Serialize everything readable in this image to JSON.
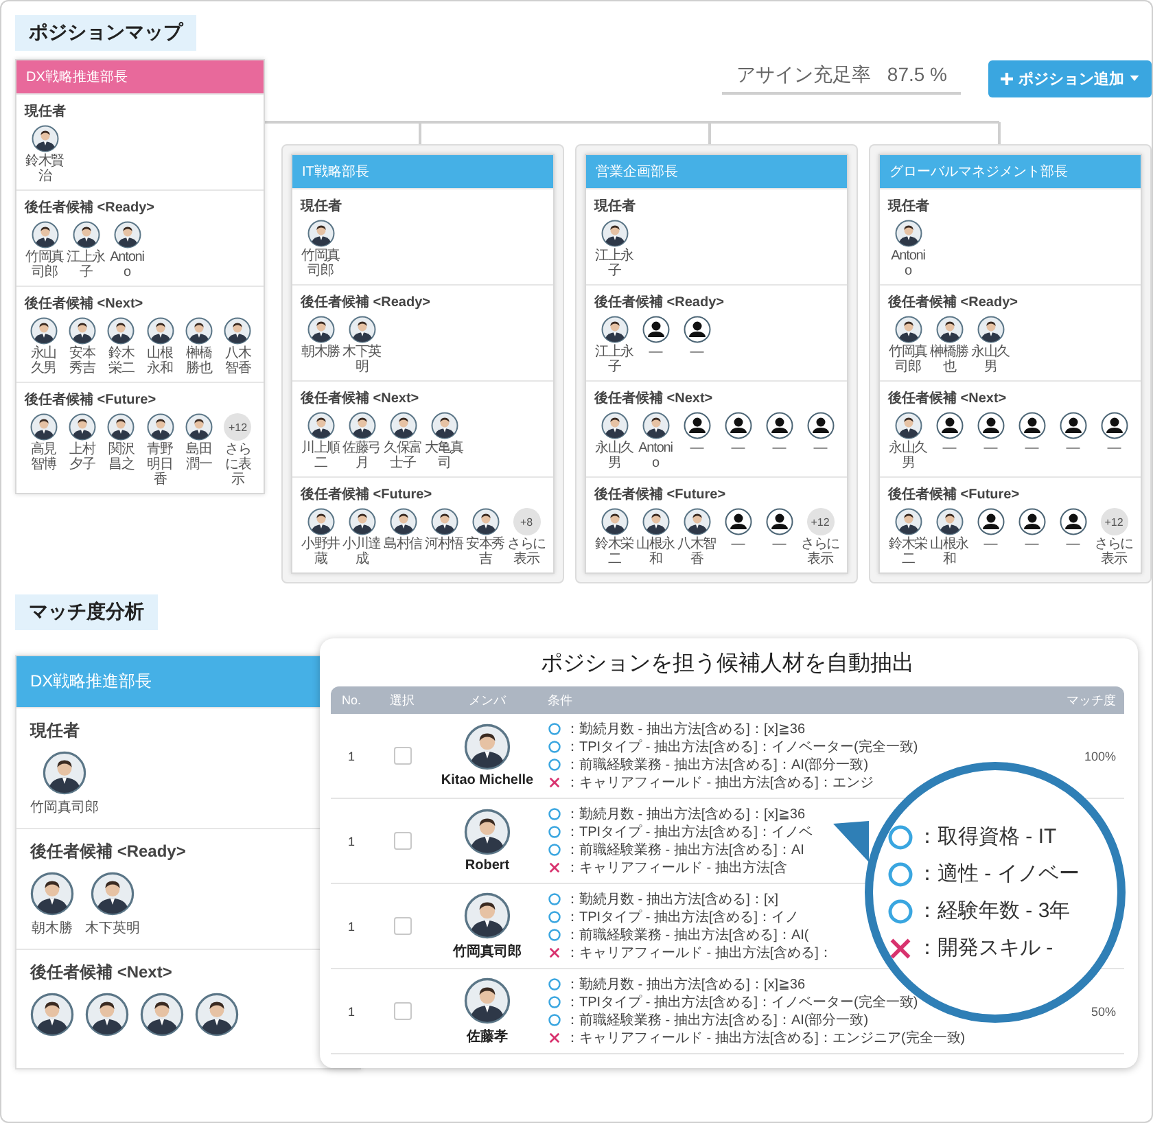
{
  "position_map": {
    "title": "ポジションマップ",
    "fill_rate": {
      "label": "アサイン充足率",
      "value": "87.5 %"
    },
    "add_button": {
      "label": "ポジション追加"
    },
    "cards": [
      {
        "title": "DX戦略推進部長",
        "color": "#e8699b",
        "sections": [
          {
            "label": "現任者",
            "members": [
              {
                "name": "鈴木賢治",
                "kind": "photo"
              }
            ]
          },
          {
            "label": "後任者候補 <Ready>",
            "members": [
              {
                "name": "竹岡真司郎",
                "kind": "photo"
              },
              {
                "name": "江上永子",
                "kind": "photo"
              },
              {
                "name": "Antonio",
                "kind": "photo"
              }
            ]
          },
          {
            "label": "後任者候補 <Next>",
            "members": [
              {
                "name": "永山久男",
                "kind": "photo"
              },
              {
                "name": "安本秀吉",
                "kind": "photo"
              },
              {
                "name": "鈴木栄二",
                "kind": "photo"
              },
              {
                "name": "山根永和",
                "kind": "photo"
              },
              {
                "name": "榊橋勝也",
                "kind": "photo"
              },
              {
                "name": "八木智香",
                "kind": "photo"
              }
            ]
          },
          {
            "label": "後任者候補 <Future>",
            "members": [
              {
                "name": "高見智博",
                "kind": "photo"
              },
              {
                "name": "上村夕子",
                "kind": "photo"
              },
              {
                "name": "関沢昌之",
                "kind": "photo"
              },
              {
                "name": "青野明日香",
                "kind": "photo"
              },
              {
                "name": "島田潤一",
                "kind": "photo"
              }
            ],
            "more": {
              "count": "+12",
              "label": "さらに表示"
            }
          }
        ]
      },
      {
        "title": "IT戦略部長",
        "color": "#45b0e6",
        "sections": [
          {
            "label": "現任者",
            "members": [
              {
                "name": "竹岡真司郎",
                "kind": "photo"
              }
            ]
          },
          {
            "label": "後任者候補 <Ready>",
            "members": [
              {
                "name": "朝木勝",
                "kind": "photo"
              },
              {
                "name": "木下英明",
                "kind": "photo"
              }
            ]
          },
          {
            "label": "後任者候補 <Next>",
            "members": [
              {
                "name": "川上順二",
                "kind": "photo"
              },
              {
                "name": "佐藤弓月",
                "kind": "photo"
              },
              {
                "name": "久保富士子",
                "kind": "photo"
              },
              {
                "name": "大亀真司",
                "kind": "photo"
              }
            ]
          },
          {
            "label": "後任者候補 <Future>",
            "members": [
              {
                "name": "小野井蔵",
                "kind": "photo"
              },
              {
                "name": "小川達成",
                "kind": "photo"
              },
              {
                "name": "島村信",
                "kind": "photo"
              },
              {
                "name": "河村悟",
                "kind": "photo"
              },
              {
                "name": "安本秀吉",
                "kind": "photo"
              }
            ],
            "more": {
              "count": "+8",
              "label": "さらに表示"
            }
          }
        ]
      },
      {
        "title": "営業企画部長",
        "color": "#45b0e6",
        "sections": [
          {
            "label": "現任者",
            "members": [
              {
                "name": "江上永子",
                "kind": "photo"
              }
            ]
          },
          {
            "label": "後任者候補 <Ready>",
            "members": [
              {
                "name": "江上永子",
                "kind": "photo"
              },
              {
                "name": "—",
                "kind": "placeholder"
              },
              {
                "name": "—",
                "kind": "placeholder"
              }
            ]
          },
          {
            "label": "後任者候補 <Next>",
            "members": [
              {
                "name": "永山久男",
                "kind": "photo"
              },
              {
                "name": "Antonio",
                "kind": "photo"
              },
              {
                "name": "—",
                "kind": "placeholder"
              },
              {
                "name": "—",
                "kind": "placeholder"
              },
              {
                "name": "—",
                "kind": "placeholder"
              },
              {
                "name": "—",
                "kind": "placeholder"
              }
            ]
          },
          {
            "label": "後任者候補 <Future>",
            "members": [
              {
                "name": "鈴木栄二",
                "kind": "photo"
              },
              {
                "name": "山根永和",
                "kind": "photo"
              },
              {
                "name": "八木智香",
                "kind": "photo"
              },
              {
                "name": "—",
                "kind": "placeholder"
              },
              {
                "name": "—",
                "kind": "placeholder"
              }
            ],
            "more": {
              "count": "+12",
              "label": "さらに表示"
            }
          }
        ]
      },
      {
        "title": "グローバルマネジメント部長",
        "color": "#45b0e6",
        "sections": [
          {
            "label": "現任者",
            "members": [
              {
                "name": "Antonio",
                "kind": "photo"
              }
            ]
          },
          {
            "label": "後任者候補 <Ready>",
            "members": [
              {
                "name": "竹岡真司郎",
                "kind": "photo"
              },
              {
                "name": "榊橋勝也",
                "kind": "photo"
              },
              {
                "name": "永山久男",
                "kind": "photo"
              }
            ]
          },
          {
            "label": "後任者候補 <Next>",
            "members": [
              {
                "name": "永山久男",
                "kind": "photo"
              },
              {
                "name": "—",
                "kind": "placeholder"
              },
              {
                "name": "—",
                "kind": "placeholder"
              },
              {
                "name": "—",
                "kind": "placeholder"
              },
              {
                "name": "—",
                "kind": "placeholder"
              },
              {
                "name": "—",
                "kind": "placeholder"
              }
            ]
          },
          {
            "label": "後任者候補 <Future>",
            "members": [
              {
                "name": "鈴木栄二",
                "kind": "photo"
              },
              {
                "name": "山根永和",
                "kind": "photo"
              },
              {
                "name": "—",
                "kind": "placeholder"
              },
              {
                "name": "—",
                "kind": "placeholder"
              },
              {
                "name": "—",
                "kind": "placeholder"
              }
            ],
            "more": {
              "count": "+12",
              "label": "さらに表示"
            }
          }
        ]
      }
    ]
  },
  "match_analysis": {
    "title": "マッチ度分析",
    "zoom_card": {
      "title": "DX戦略推進部長",
      "color": "#45b0e6",
      "sections": [
        {
          "label": "現任者",
          "members": [
            {
              "name": "竹岡真司郎",
              "kind": "photo"
            }
          ]
        },
        {
          "label": "後任者候補 <Ready>",
          "members": [
            {
              "name": "朝木勝",
              "kind": "photo"
            },
            {
              "name": "木下英明",
              "kind": "photo"
            }
          ]
        },
        {
          "label": "後任者候補 <Next>",
          "members": [
            {
              "kind": "photo"
            },
            {
              "kind": "photo"
            },
            {
              "kind": "photo"
            },
            {
              "kind": "photo"
            }
          ]
        }
      ]
    },
    "panel": {
      "title": "ポジションを担う候補人材を自動抽出",
      "columns": [
        "No.",
        "選択",
        "メンバ",
        "条件",
        "マッチ度"
      ],
      "rows": [
        {
          "no": "1",
          "checked": false,
          "member": {
            "name": "Kitao Michelle",
            "kind": "photo"
          },
          "conditions": [
            {
              "ok": true,
              "text": "：勤続月数 - 抽出方法[含める]：[x]≧36"
            },
            {
              "ok": true,
              "text": "：TPIタイプ - 抽出方法[含める]：イノベーター(完全一致)"
            },
            {
              "ok": true,
              "text": "：前職経験業務 - 抽出方法[含める]：AI(部分一致)"
            },
            {
              "ok": false,
              "text": "：キャリアフィールド - 抽出方法[含める]：エンジ"
            }
          ],
          "match": "100%"
        },
        {
          "no": "1",
          "checked": false,
          "member": {
            "name": "Robert",
            "kind": "photo"
          },
          "conditions": [
            {
              "ok": true,
              "text": "：勤続月数 - 抽出方法[含める]：[x]≧36"
            },
            {
              "ok": true,
              "text": "：TPIタイプ - 抽出方法[含める]：イノベ"
            },
            {
              "ok": true,
              "text": "：前職経験業務 - 抽出方法[含める]：AI"
            },
            {
              "ok": false,
              "text": "：キャリアフィールド - 抽出方法[含"
            }
          ]
        },
        {
          "no": "1",
          "checked": false,
          "member": {
            "name": "竹岡真司郎",
            "kind": "photo"
          },
          "conditions": [
            {
              "ok": true,
              "text": "：勤続月数 - 抽出方法[含める]：[x]"
            },
            {
              "ok": true,
              "text": "：TPIタイプ - 抽出方法[含める]：イノ"
            },
            {
              "ok": true,
              "text": "：前職経験業務 - 抽出方法[含める]：AI("
            },
            {
              "ok": false,
              "text": "：キャリアフィールド - 抽出方法[含める]："
            }
          ]
        },
        {
          "no": "1",
          "checked": false,
          "member": {
            "name": "佐藤孝",
            "kind": "photo"
          },
          "conditions": [
            {
              "ok": true,
              "text": "：勤続月数 - 抽出方法[含める]：[x]≧36"
            },
            {
              "ok": true,
              "text": "：TPIタイプ - 抽出方法[含める]：イノベーター(完全一致)"
            },
            {
              "ok": true,
              "text": "：前職経験業務 - 抽出方法[含める]：AI(部分一致)"
            },
            {
              "ok": false,
              "text": "：キャリアフィールド - 抽出方法[含める]：エンジニア(完全一致)"
            }
          ],
          "match": "50%"
        }
      ],
      "magnifier": {
        "items": [
          {
            "ok": true,
            "text": "：取得資格 - IT"
          },
          {
            "ok": true,
            "text": "：適性 - イノベー"
          },
          {
            "ok": true,
            "text": "：経験年数 - 3年"
          },
          {
            "ok": false,
            "text": "：開発スキル -"
          }
        ]
      }
    }
  }
}
